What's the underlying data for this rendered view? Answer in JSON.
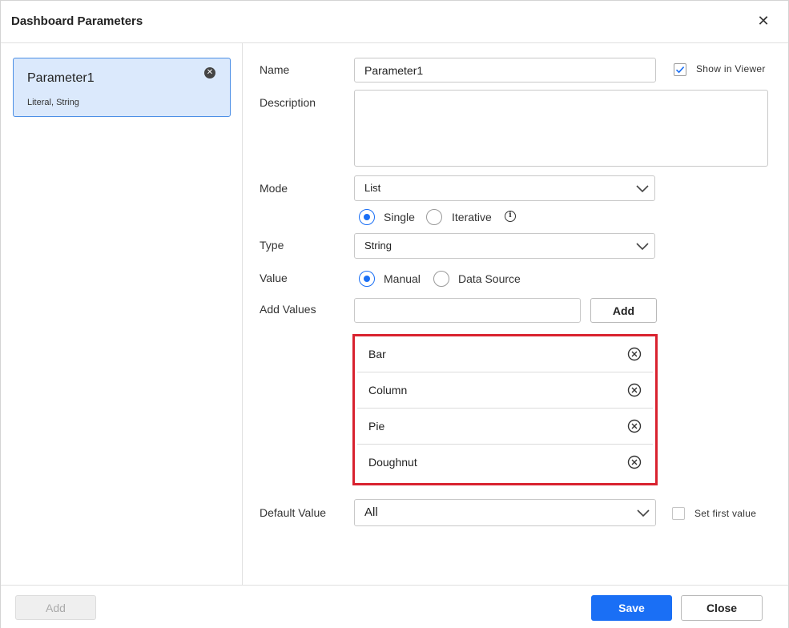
{
  "dialog": {
    "title": "Dashboard Parameters",
    "close_icon": "close-icon"
  },
  "parameters": [
    {
      "name": "Parameter1",
      "subtitle": "Literal, String",
      "remove_icon": "remove-circle-icon"
    }
  ],
  "form": {
    "name_label": "Name",
    "name_value": "Parameter1",
    "show_in_viewer_label": "Show in Viewer",
    "show_in_viewer_checked": true,
    "description_label": "Description",
    "description_value": "",
    "mode_label": "Mode",
    "mode_value": "List",
    "mode_options": {
      "single": "Single",
      "iterative": "Iterative",
      "selected": "Single"
    },
    "type_label": "Type",
    "type_value": "String",
    "value_label": "Value",
    "value_options": {
      "manual": "Manual",
      "data_source": "Data Source",
      "selected": "Manual"
    },
    "add_values_label": "Add Values",
    "add_values_input": "",
    "add_button": "Add",
    "values": [
      "Bar",
      "Column",
      "Pie",
      "Doughnut"
    ],
    "default_value_label": "Default Value",
    "default_value": "All",
    "set_first_value_label": "Set first value",
    "set_first_value_checked": false
  },
  "footer": {
    "add_label": "Add",
    "save_label": "Save",
    "close_label": "Close"
  },
  "colors": {
    "accent": "#1a6ff5",
    "selected_bg": "#dbe9fc",
    "highlight_border": "#d9222f"
  }
}
